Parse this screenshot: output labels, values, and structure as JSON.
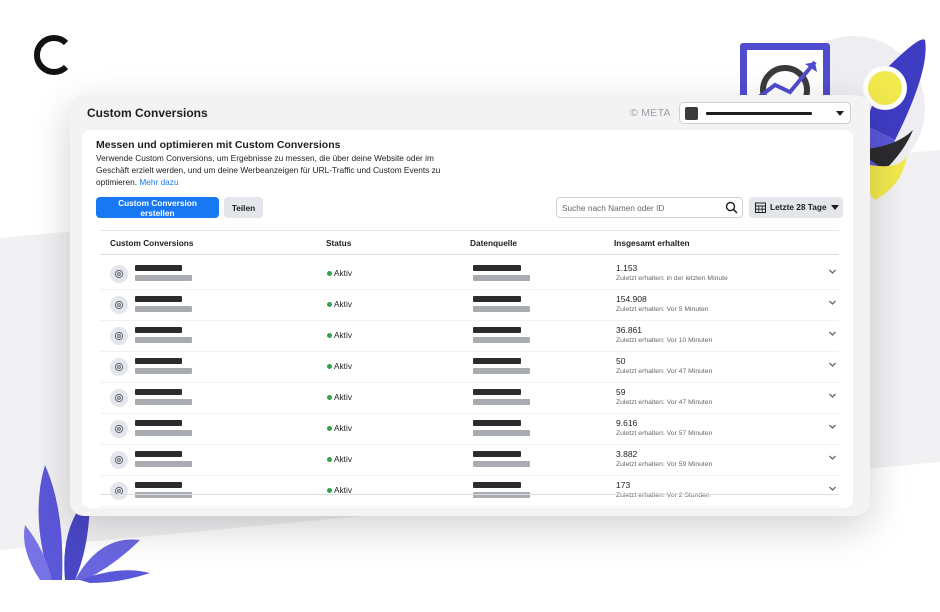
{
  "header": {
    "title": "Custom Conversions",
    "meta_label": "© META"
  },
  "intro": {
    "title": "Messen und optimieren mit Custom Conversions",
    "text": "Verwende Custom Conversions, um Ergebnisse zu messen, die über deine Website oder im Geschäft erzielt werden, und um deine Werbeanzeigen für URL-Traffic und Custom Events zu optimieren.",
    "link": "Mehr dazu"
  },
  "toolbar": {
    "create_label": "Custom Conversion erstellen",
    "share_label": "Teilen",
    "search_placeholder": "Suche nach Namen oder ID",
    "date_label": "Letzte 28 Tage"
  },
  "table": {
    "columns": [
      "Custom Conversions",
      "Status",
      "Datenquelle",
      "Insgesamt erhalten"
    ],
    "rows": [
      {
        "status": "Aktiv",
        "total": "1.153",
        "last": "Zuletzt erhalten: in der letzten Minute"
      },
      {
        "status": "Aktiv",
        "total": "154.908",
        "last": "Zuletzt erhalten: Vor 5 Minuten"
      },
      {
        "status": "Aktiv",
        "total": "36.861",
        "last": "Zuletzt erhalten: Vor 10 Minuten"
      },
      {
        "status": "Aktiv",
        "total": "50",
        "last": "Zuletzt erhalten: Vor 47 Minuten"
      },
      {
        "status": "Aktiv",
        "total": "59",
        "last": "Zuletzt erhalten: Vor 47 Minuten"
      },
      {
        "status": "Aktiv",
        "total": "9.616",
        "last": "Zuletzt erhalten: Vor 57 Minuten"
      },
      {
        "status": "Aktiv",
        "total": "3.882",
        "last": "Zuletzt erhalten: Vor 59 Minuten"
      },
      {
        "status": "Aktiv",
        "total": "173",
        "last": "Zuletzt erhalten: Vor 2 Stunden"
      }
    ]
  },
  "colors": {
    "accent": "#1877f2",
    "active": "#31a24c",
    "decor_purple": "#5b57d9",
    "decor_yellow": "#f2e94e"
  },
  "icons": [
    "logo-c-icon",
    "search-icon",
    "calendar-icon",
    "chevron-down-icon",
    "conversion-icon",
    "rocket-illustration",
    "plant-illustration"
  ]
}
